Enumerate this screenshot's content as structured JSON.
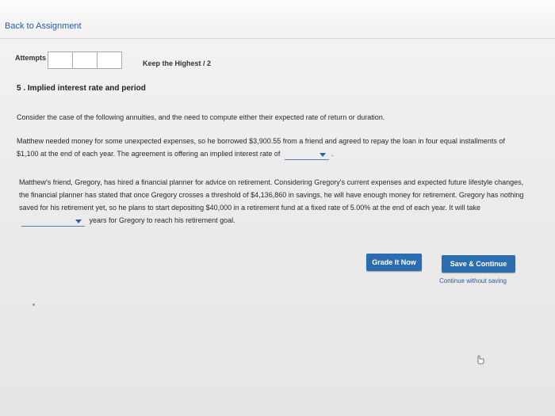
{
  "header": {
    "back_link": "Back to Assignment"
  },
  "attempts": {
    "label": "Attempts",
    "keep_highest": "Keep the Highest / 2"
  },
  "question": {
    "title": "5 . Implied interest rate and period",
    "intro": "Consider the case of the following annuities, and the need to compute either their expected rate of return or duration.",
    "p2_before": "Matthew needed money for some unexpected expenses, so he borrowed $3,900.55 from a friend and agreed to repay the loan in four equal installments of $1,100 at the end of each year. The agreement is offering an implied interest rate of",
    "p2_after": ".",
    "p3_before": "Matthew's friend, Gregory, has hired a financial planner for advice on retirement. Considering Gregory's current expenses and expected future lifestyle changes, the financial planner has stated that once Gregory crosses a threshold of $4,136,860 in savings, he will have enough money for retirement. Gregory has nothing saved for his retirement yet, so he plans to start depositing $40,000 in a retirement fund at a fixed rate of 5.00% at the end of each year. It will take",
    "p3_after": "years for Gregory to reach his retirement goal."
  },
  "actions": {
    "grade": "Grade It Now",
    "save": "Save & Continue",
    "continue_without_saving": "Continue without saving"
  }
}
